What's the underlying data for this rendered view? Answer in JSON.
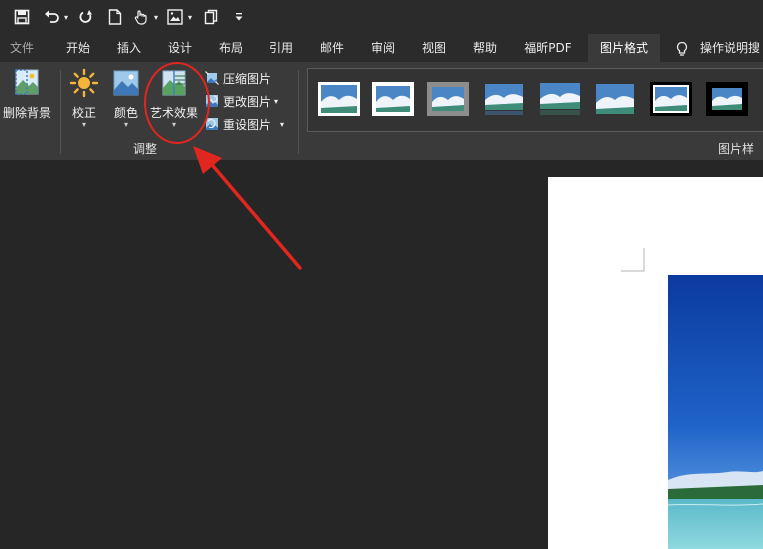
{
  "ribbon_tabs": {
    "file": "文件",
    "home": "开始",
    "insert": "插入",
    "design": "设计",
    "layout": "布局",
    "references": "引用",
    "mailings": "邮件",
    "review": "审阅",
    "view": "视图",
    "help": "帮助",
    "foxit_pdf": "福昕PDF",
    "picture_format": "图片格式"
  },
  "tell_me": "操作说明搜",
  "adjust_group": {
    "remove_background": "删除背景",
    "corrections": "校正",
    "color": "颜色",
    "artistic_effects": "艺术效果",
    "compress_pictures": "压缩图片",
    "change_picture": "更改图片",
    "reset_picture": "重设图片",
    "group_label": "调整"
  },
  "picture_styles_label": "图片样式",
  "colors": {
    "annotation": "#e0261f",
    "ribbon_bg": "#3a3a3a",
    "titlebar_bg": "#2b2b2b",
    "document_bg": "#262626"
  }
}
